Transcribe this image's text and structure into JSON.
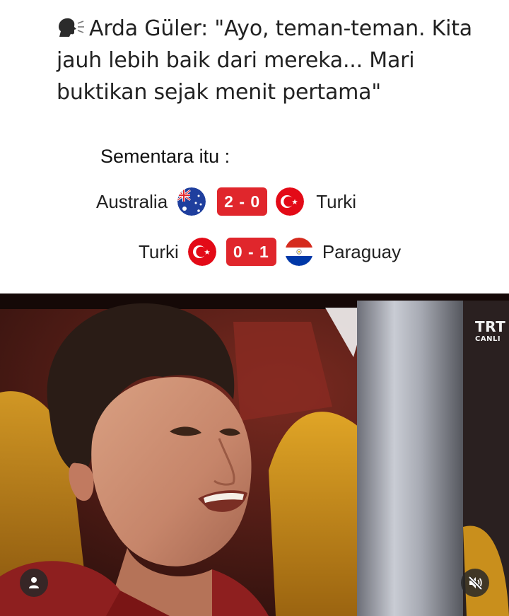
{
  "post": {
    "quote_text": "Arda Güler: \"Ayo, teman-teman. Kita jauh lebih baik dari mereka... Mari buktikan sejak menit pertama\"",
    "speaker_icon": "speaking-head-icon"
  },
  "scores": {
    "heading": "Sementara itu :",
    "matches": [
      {
        "home_team": "Australia",
        "home_flag": "australia-flag-icon",
        "score": "2 - 0",
        "away_team": "Turki",
        "away_flag": "turkey-flag-icon"
      },
      {
        "home_team": "Turki",
        "home_flag": "turkey-flag-icon",
        "score": "0 - 1",
        "away_team": "Paraguay",
        "away_flag": "paraguay-flag-icon"
      }
    ],
    "score_color": "#e0262c"
  },
  "video": {
    "channel_logo": "TRT",
    "live_label": "CANLI",
    "profile_icon": "profile-icon",
    "mute_icon": "muted-speaker-icon"
  }
}
